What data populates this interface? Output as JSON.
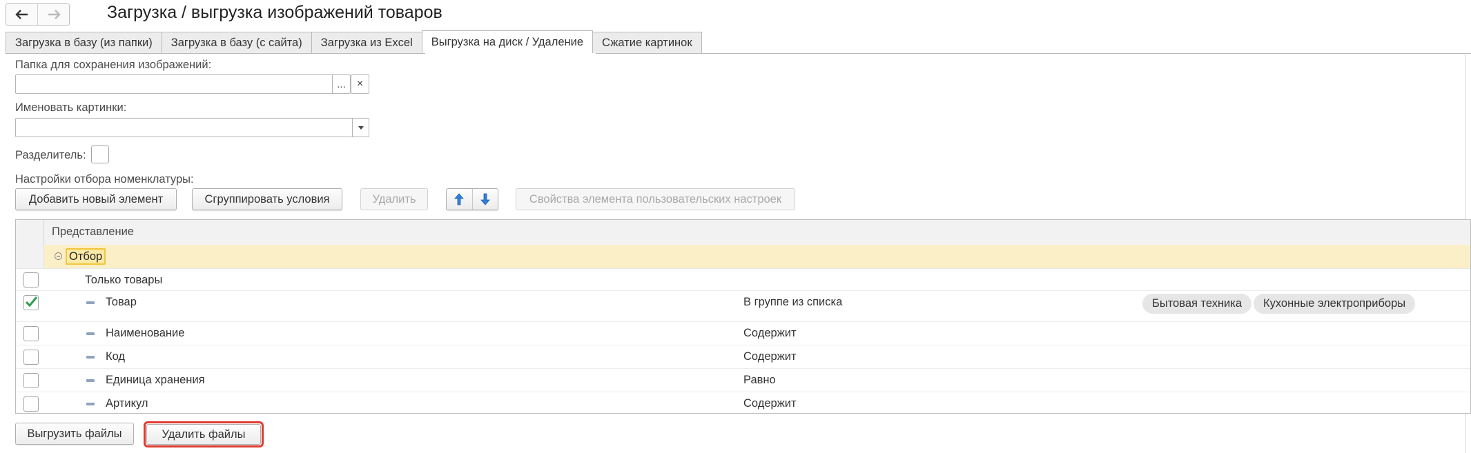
{
  "window": {
    "title": "Загрузка / выгрузка изображений товаров",
    "back_glyph": "←",
    "forward_glyph": "→"
  },
  "tabs": [
    {
      "label": "Загрузка в базу (из папки)",
      "active": false
    },
    {
      "label": "Загрузка в базу (с сайта)",
      "active": false
    },
    {
      "label": "Загрузка из Excel",
      "active": false
    },
    {
      "label": "Выгрузка на диск / Удаление",
      "active": true
    },
    {
      "label": "Сжатие картинок",
      "active": false
    }
  ],
  "form": {
    "folder_label": "Папка для сохранения изображений:",
    "folder_value": "",
    "folder_select_glyph": "...",
    "folder_clear_glyph": "×",
    "naming_label": "Именовать картинки:",
    "naming_value": "",
    "separator_label": "Разделитель:",
    "separator_value": "",
    "filter_settings_label": "Настройки отбора номенклатуры:"
  },
  "toolbar": {
    "add_label": "Добавить новый элемент",
    "group_label": "Сгруппировать условия",
    "delete_label": "Удалить",
    "properties_label": "Свойства элемента пользовательских настроек"
  },
  "table": {
    "header": "Представление",
    "group_label": "Отбор",
    "rows": [
      {
        "label": "Только товары",
        "checked": false,
        "condition": "",
        "values": []
      },
      {
        "label": "Товар",
        "checked": true,
        "condition": "В группе из списка",
        "values": [
          "Бытовая техника",
          "Кухонные электроприборы"
        ]
      },
      {
        "label": "Наименование",
        "checked": false,
        "condition": "Содержит",
        "values": []
      },
      {
        "label": "Код",
        "checked": false,
        "condition": "Содержит",
        "values": []
      },
      {
        "label": "Единица хранения",
        "checked": false,
        "condition": "Равно",
        "values": []
      },
      {
        "label": "Артикул",
        "checked": false,
        "condition": "Содержит",
        "values": []
      }
    ]
  },
  "footer": {
    "export_label": "Выгрузить файлы",
    "delete_files_label": "Удалить файлы"
  },
  "colors": {
    "selected_row": "#fbefc8",
    "highlight_border": "#e03a2f",
    "checkmark": "#2e9e4f",
    "arrow_blue": "#2f7fd6"
  }
}
